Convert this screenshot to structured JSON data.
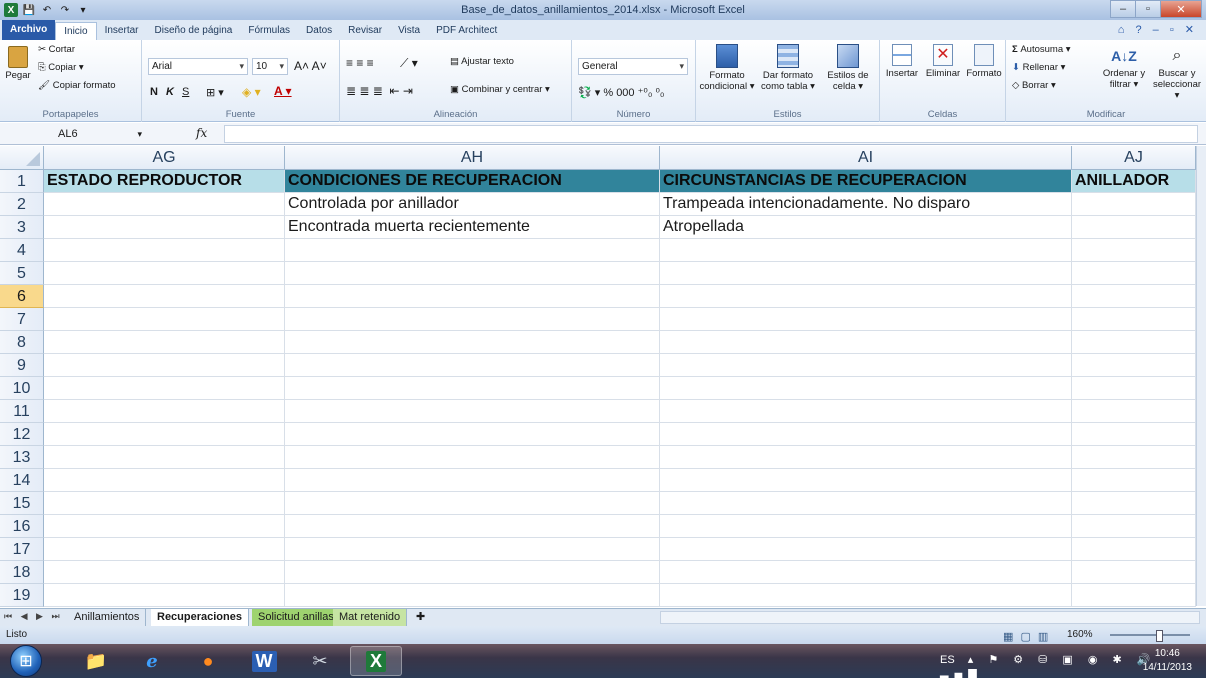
{
  "window": {
    "title": "Base_de_datos_anillamientos_2014.xlsx - Microsoft Excel",
    "controls": [
      "–",
      "▫",
      "✕"
    ]
  },
  "menu_tabs": [
    "Archivo",
    "Inicio",
    "Insertar",
    "Diseño de página",
    "Fórmulas",
    "Datos",
    "Revisar",
    "Vista",
    "PDF Architect"
  ],
  "ribbon": {
    "portapapeles": {
      "label": "Portapapeles",
      "pegar": "Pegar",
      "cortar": "Cortar",
      "copiar": "Copiar",
      "copiar_formato": "Copiar formato"
    },
    "fuente": {
      "label": "Fuente",
      "font": "Arial",
      "size": "10",
      "bold": "N",
      "italic": "K",
      "underline": "S"
    },
    "alineacion": {
      "label": "Alineación",
      "ajustar": "Ajustar texto",
      "combinar": "Combinar y centrar"
    },
    "numero": {
      "label": "Número",
      "format": "General",
      "percent": "%",
      "thousands": "000"
    },
    "estilos": {
      "label": "Estilos",
      "formato_condicional": "Formato condicional",
      "formato_tabla": "Dar formato como tabla",
      "estilos_celda": "Estilos de celda"
    },
    "celdas": {
      "label": "Celdas",
      "insertar": "Insertar",
      "eliminar": "Eliminar",
      "formato": "Formato"
    },
    "modificar": {
      "label": "Modificar",
      "autosuma": "Autosuma",
      "rellenar": "Rellenar",
      "borrar": "Borrar",
      "ordenar": "Ordenar y filtrar",
      "buscar": "Buscar y seleccionar"
    }
  },
  "formula_bar": {
    "name_box": "AL6",
    "fx": "fx",
    "value": ""
  },
  "grid": {
    "columns": [
      "AG",
      "AH",
      "AI",
      "AJ"
    ],
    "rows": [
      "1",
      "2",
      "3",
      "4",
      "5",
      "6",
      "7",
      "8",
      "9",
      "10",
      "11",
      "12",
      "13",
      "14",
      "15",
      "16",
      "17",
      "18",
      "19"
    ],
    "selected_row": "6",
    "header_row": [
      "ESTADO REPRODUCTOR",
      "CONDICIONES DE RECUPERACION",
      "CIRCUNSTANCIAS DE RECUPERACION",
      "ANILLADOR"
    ],
    "data": [
      [
        "",
        "Controlada por anillador",
        "Trampeada intencionadamente. No disparo",
        ""
      ],
      [
        "",
        "Encontrada muerta recientemente",
        "Atropellada",
        ""
      ]
    ]
  },
  "sheet_tabs": [
    "Anillamientos",
    "Recuperaciones",
    "Solicitud anillas",
    "Mat retenido"
  ],
  "active_sheet": "Recuperaciones",
  "status": {
    "ready": "Listo",
    "zoom": "160%"
  },
  "taskbar": {
    "language": "ES",
    "time": "10:46",
    "date": "14/11/2013"
  }
}
